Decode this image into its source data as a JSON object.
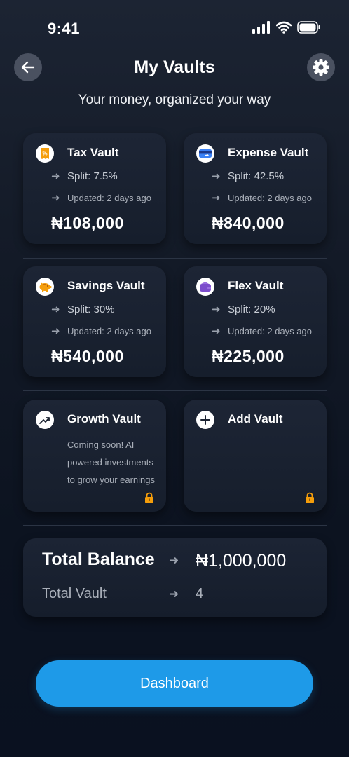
{
  "status_bar": {
    "time": "9:41"
  },
  "header": {
    "title": "My Vaults",
    "subtitle": "Your money, organized your way"
  },
  "vaults": [
    {
      "title": "Tax Vault",
      "split": "Split: 7.5%",
      "updated": "Updated: 2 days ago",
      "amount": "₦108,000",
      "icon": "receipt-icon",
      "icon_color": "#f59e0b"
    },
    {
      "title": "Expense Vault",
      "split": "Split: 42.5%",
      "updated": "Updated: 2 days ago",
      "amount": "₦840,000",
      "icon": "card-icon",
      "icon_color": "#3b82f6"
    },
    {
      "title": "Savings Vault",
      "split": "Split: 30%",
      "updated": "Updated: 2 days ago",
      "amount": "₦540,000",
      "icon": "piggy-bank-icon",
      "icon_color": "#f59e0b"
    },
    {
      "title": "Flex Vault",
      "split": "Split: 20%",
      "updated": "Updated: 2 days ago",
      "amount": "₦225,000",
      "icon": "wallet-icon",
      "icon_color": "#7c4dcc"
    }
  ],
  "growth_vault": {
    "title": "Growth Vault",
    "description": "Coming soon! AI powered investments to grow your earnings",
    "icon": "trend-up-icon"
  },
  "add_vault": {
    "title": "Add Vault",
    "icon": "plus-icon"
  },
  "summary": {
    "total_balance_label": "Total Balance",
    "total_balance_value": "₦1,000,000",
    "total_vault_label": "Total Vault",
    "total_vault_value": "4"
  },
  "dashboard_button": "Dashboard",
  "colors": {
    "accent": "#1e9ae8",
    "lock": "#f59e0b",
    "background": "#0c1320"
  }
}
